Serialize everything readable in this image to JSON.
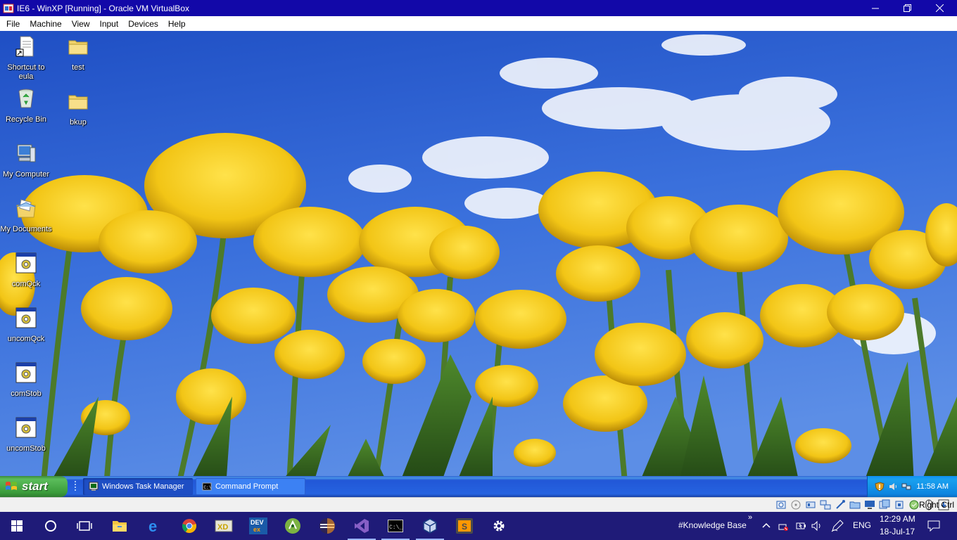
{
  "vbox": {
    "title": "IE6 - WinXP [Running] - Oracle VM VirtualBox",
    "menu": [
      "File",
      "Machine",
      "View",
      "Input",
      "Devices",
      "Help"
    ],
    "host_key": "Right Ctrl"
  },
  "desktop": {
    "icons": [
      {
        "label": "Shortcut to eula",
        "icon": "document-shortcut-icon"
      },
      {
        "label": "test",
        "icon": "folder-icon"
      },
      {
        "label": "Recycle Bin",
        "icon": "recycle-bin-icon"
      },
      {
        "label": "bkup",
        "icon": "folder-icon"
      },
      {
        "label": "My Computer",
        "icon": "my-computer-icon"
      },
      {
        "label": "My Documents",
        "icon": "my-documents-icon"
      },
      {
        "label": "comQck",
        "icon": "batch-file-icon"
      },
      {
        "label": "uncomQck",
        "icon": "batch-file-icon"
      },
      {
        "label": "comStob",
        "icon": "batch-file-icon"
      },
      {
        "label": "uncomStob",
        "icon": "batch-file-icon"
      }
    ]
  },
  "xp_taskbar": {
    "start_label": "start",
    "tasks": [
      {
        "label": "Windows Task Manager",
        "icon": "task-manager-icon"
      },
      {
        "label": "Command Prompt",
        "icon": "command-prompt-icon"
      }
    ],
    "clock": "11:58 AM"
  },
  "host_taskbar": {
    "pinned": [
      "windows-start-icon",
      "cortana-icon",
      "task-view-icon",
      "file-explorer-icon",
      "edge-icon",
      "chrome-icon",
      "app-xd-icon",
      "devex-icon",
      "android-studio-icon",
      "eclipse-icon",
      "visual-studio-icon",
      "terminal-icon",
      "virtualbox-icon",
      "sublime-text-icon",
      "settings-icon"
    ],
    "toolbar_label": "#Knowledge Base",
    "language": "ENG",
    "time": "12:29 AM",
    "date": "18-Jul-17"
  },
  "colors": {
    "vbox_title_bg": "#1208a8",
    "host_taskbar_bg": "#1f1b78",
    "xp_taskbar_blue": "#2663e0",
    "xp_start_green": "#3a9b3a",
    "tulip_yellow": "#f2c516",
    "sky_blue": "#2f63d6"
  }
}
